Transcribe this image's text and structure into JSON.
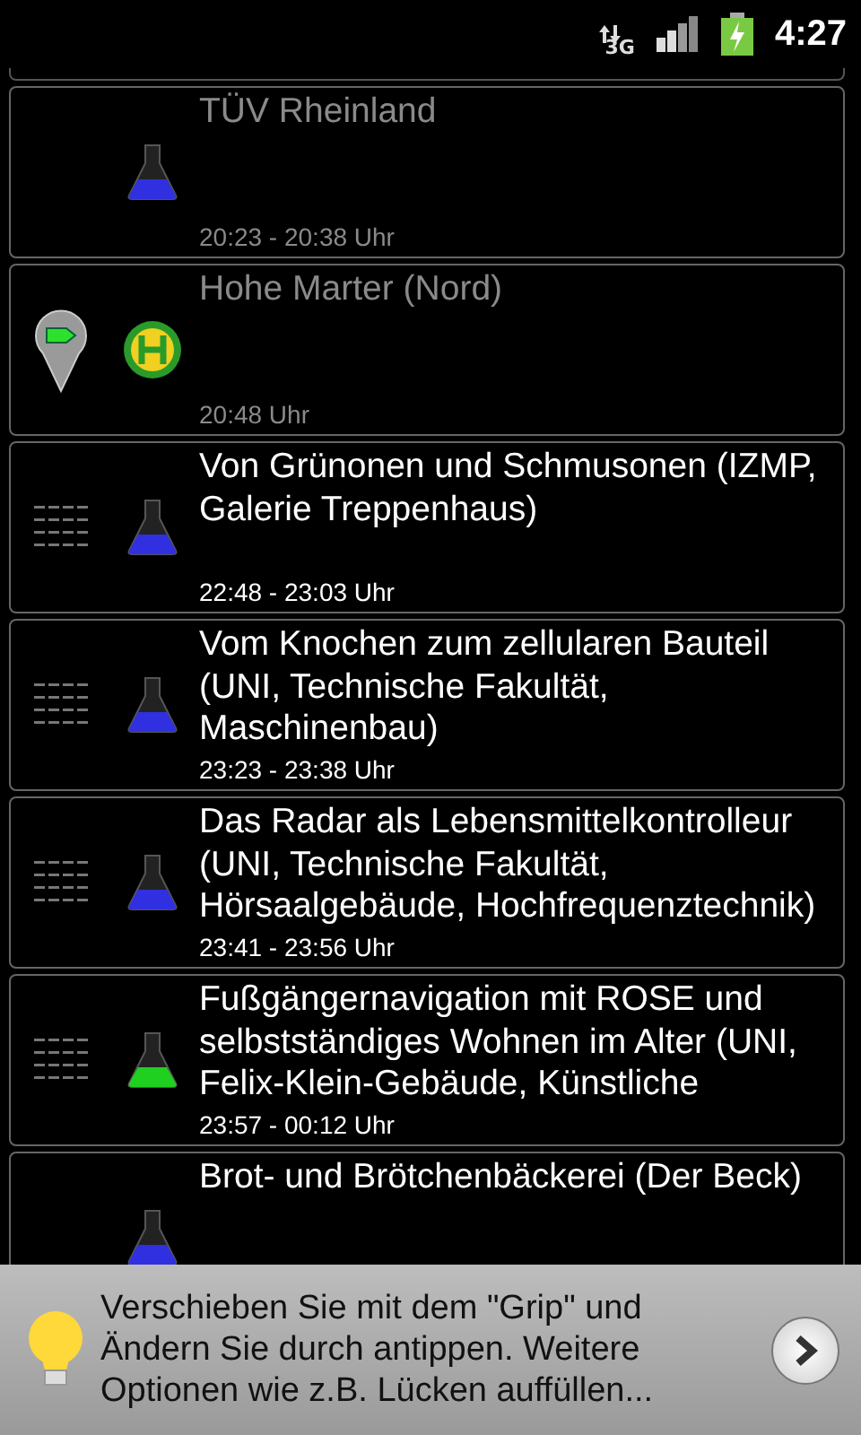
{
  "status_bar": {
    "network": "3G",
    "time": "4:27"
  },
  "items": [
    {
      "grip": false,
      "pin": false,
      "kind": "flask",
      "color": "#3030e0",
      "dimmed": true,
      "title": "TÜV Rheinland",
      "time": "20:23 - 20:38 Uhr"
    },
    {
      "grip": false,
      "pin": true,
      "kind": "bus-stop",
      "dimmed": true,
      "title": "Hohe Marter (Nord)",
      "time": "20:48 Uhr"
    },
    {
      "grip": true,
      "pin": false,
      "kind": "flask",
      "color": "#3030e0",
      "dimmed": false,
      "title": "Von Grünonen und Schmusonen (IZMP, Galerie Treppenhaus)",
      "time": "22:48 - 23:03 Uhr"
    },
    {
      "grip": true,
      "pin": false,
      "kind": "flask",
      "color": "#3030e0",
      "dimmed": false,
      "title": "Vom Knochen zum zellularen Bauteil (UNI, Technische Fakultät, Maschinenbau)",
      "time": "23:23 - 23:38 Uhr"
    },
    {
      "grip": true,
      "pin": false,
      "kind": "flask",
      "color": "#3030e0",
      "dimmed": false,
      "title": "Das Radar als Lebensmittelkontrolleur (UNI, Technische Fakultät, Hörsaalgebäude, Hochfrequenztechnik)",
      "time": "23:41 - 23:56 Uhr"
    },
    {
      "grip": true,
      "pin": false,
      "kind": "flask",
      "color": "#20d020",
      "dimmed": false,
      "title": "Fußgängernavigation mit ROSE und selbstständiges Wohnen im Alter (UNI, Felix-Klein-Gebäude, Künstliche",
      "time": "23:57 - 00:12 Uhr"
    },
    {
      "grip": false,
      "pin": false,
      "kind": "flask",
      "color": "#3030e0",
      "dimmed": false,
      "title": "Brot- und Brötchenbäckerei (Der Beck)"
    }
  ],
  "hint": {
    "text": "Verschieben Sie mit dem \"Grip\" und Ändern Sie durch antippen. Weitere Optionen wie z.B. Lücken auffüllen..."
  }
}
